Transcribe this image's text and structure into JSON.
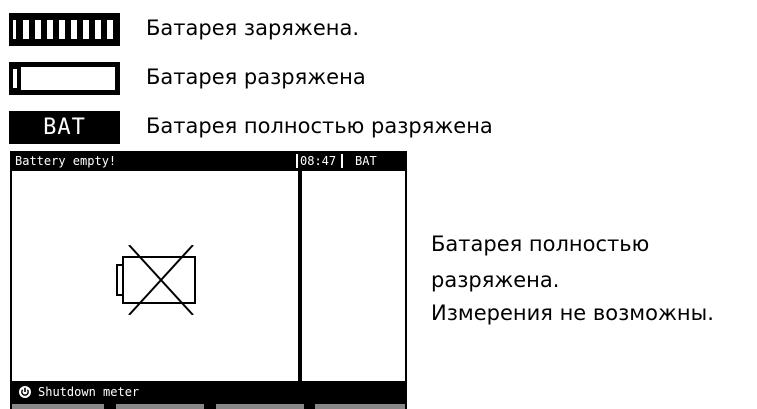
{
  "legend": [
    {
      "icon": "battery-full-icon",
      "text": "Батарея заряжена."
    },
    {
      "icon": "battery-empty-icon",
      "text": "Батарея разряжена"
    },
    {
      "icon": "battery-bat-icon",
      "icon_text": "BAT",
      "text": "Батарея полностью разряжена"
    }
  ],
  "screen": {
    "status_message": "Battery empty!",
    "time": "08:47",
    "battery_indicator": "BAT",
    "main_icon": "battery-crossed-icon",
    "bottom_icon": "power-icon",
    "bottom_text": "Shutdown meter",
    "softkey_color": "#888888"
  },
  "description": {
    "line1": "Батарея полностью",
    "line2": "разряжена.",
    "line3": "Измерения не возможны."
  }
}
